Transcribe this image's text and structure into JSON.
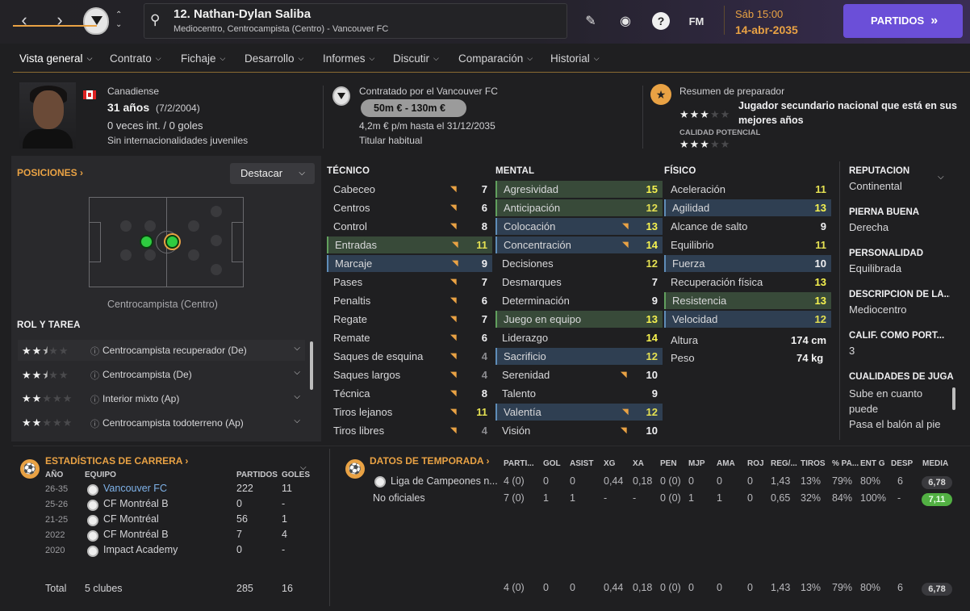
{
  "header": {
    "player_name": "12. Nathan-Dylan Saliba",
    "player_sub": "Mediocentro, Centrocampista (Centro) - Vancouver FC",
    "fm_label": "FM",
    "date_day": "Sáb 15:00",
    "date": "14-abr-2035",
    "partidos_label": "PARTIDOS",
    "icons": [
      "back-arrow-icon",
      "forward-arrow-icon",
      "club-crest-icon",
      "search-icon",
      "pencil-icon",
      "globe-icon",
      "help-icon"
    ]
  },
  "tabs": [
    {
      "label": "Vista general",
      "active": true
    },
    {
      "label": "Contrato"
    },
    {
      "label": "Fichaje"
    },
    {
      "label": "Desarrollo"
    },
    {
      "label": "Informes"
    },
    {
      "label": "Discutir"
    },
    {
      "label": "Comparación"
    },
    {
      "label": "Historial"
    }
  ],
  "profile": {
    "nationality": "Canadiense",
    "age": "31 años",
    "dob": "(7/2/2004)",
    "caps": "0 veces int. / 0 goles",
    "youth": "Sin internacionalidades juveniles"
  },
  "contract": {
    "signed_by": "Contratado por el Vancouver FC",
    "value": "50m € - 130m €",
    "wage": "4,2m € p/m hasta el 31/12/2035",
    "status": "Titular habitual"
  },
  "coach": {
    "title": "Resumen de preparador",
    "summary": "Jugador secundario nacional que está en sus mejores años",
    "current_stars": 3,
    "potential_label": "CALIDAD POTENCIAL",
    "potential_stars": 3
  },
  "positions": {
    "title": "POSICIONES",
    "destacar": "Destacar",
    "caption": "Centrocampista (Centro)",
    "roles_title": "ROL Y TAREA",
    "roles": [
      {
        "label": "Centrocampista recuperador (De)",
        "stars": 2.5,
        "selected": true
      },
      {
        "label": "Centrocampista (De)",
        "stars": 2.5
      },
      {
        "label": "Interior mixto (Ap)",
        "stars": 2
      },
      {
        "label": "Centrocampista todoterreno (Ap)",
        "stars": 2
      }
    ]
  },
  "attributes": {
    "tecnico_title": "TÉCNICO",
    "mental_title": "MENTAL",
    "fisico_title": "FÍSICO",
    "tecnico": [
      {
        "name": "Cabeceo",
        "value": "7",
        "arrow": true
      },
      {
        "name": "Centros",
        "value": "6",
        "arrow": true
      },
      {
        "name": "Control",
        "value": "8",
        "arrow": true
      },
      {
        "name": "Entradas",
        "value": "11",
        "arrow": true,
        "hl": "g"
      },
      {
        "name": "Marcaje",
        "value": "9",
        "arrow": true,
        "hl": "b"
      },
      {
        "name": "Pases",
        "value": "7",
        "arrow": true
      },
      {
        "name": "Penaltis",
        "value": "6",
        "arrow": true
      },
      {
        "name": "Regate",
        "value": "7",
        "arrow": true
      },
      {
        "name": "Remate",
        "value": "6",
        "arrow": true
      },
      {
        "name": "Saques de esquina",
        "value": "4",
        "arrow": true
      },
      {
        "name": "Saques largos",
        "value": "4",
        "arrow": true
      },
      {
        "name": "Técnica",
        "value": "8",
        "arrow": true
      },
      {
        "name": "Tiros lejanos",
        "value": "11",
        "arrow": true
      },
      {
        "name": "Tiros libres",
        "value": "4",
        "arrow": true
      }
    ],
    "mental": [
      {
        "name": "Agresividad",
        "value": "15",
        "hl": "g"
      },
      {
        "name": "Anticipación",
        "value": "12",
        "hl": "g"
      },
      {
        "name": "Colocación",
        "value": "13",
        "arrow": true,
        "hl": "b"
      },
      {
        "name": "Concentración",
        "value": "14",
        "arrow": true,
        "hl": "b"
      },
      {
        "name": "Decisiones",
        "value": "12"
      },
      {
        "name": "Desmarques",
        "value": "7"
      },
      {
        "name": "Determinación",
        "value": "9"
      },
      {
        "name": "Juego en equipo",
        "value": "13",
        "hl": "g"
      },
      {
        "name": "Liderazgo",
        "value": "14"
      },
      {
        "name": "Sacrificio",
        "value": "12",
        "hl": "b"
      },
      {
        "name": "Serenidad",
        "value": "10",
        "arrow": true
      },
      {
        "name": "Talento",
        "value": "9"
      },
      {
        "name": "Valentía",
        "value": "12",
        "arrow": true,
        "hl": "b"
      },
      {
        "name": "Visión",
        "value": "10",
        "arrow": true
      }
    ],
    "fisico": [
      {
        "name": "Aceleración",
        "value": "11"
      },
      {
        "name": "Agilidad",
        "value": "13",
        "hl": "b"
      },
      {
        "name": "Alcance de salto",
        "value": "9"
      },
      {
        "name": "Equilibrio",
        "value": "11"
      },
      {
        "name": "Fuerza",
        "value": "10",
        "hl": "b"
      },
      {
        "name": "Recuperación física",
        "value": "13"
      },
      {
        "name": "Resistencia",
        "value": "13",
        "hl": "g"
      },
      {
        "name": "Velocidad",
        "value": "12",
        "hl": "b"
      }
    ],
    "height_label": "Altura",
    "height": "174 cm",
    "weight_label": "Peso",
    "weight": "74 kg"
  },
  "info": [
    {
      "label": "REPUTACIÓN",
      "value": "Continental"
    },
    {
      "label": "PIERNA BUENA",
      "value": "Derecha"
    },
    {
      "label": "PERSONALIDAD",
      "value": "Equilibrada"
    },
    {
      "label": "DESCRIPCIÓN DE LA...",
      "value": "Mediocentro"
    },
    {
      "label": "CALIF. COMO PORT...",
      "value": "3"
    },
    {
      "label": "CUALIDADES DE JUGA",
      "value": "Sube en cuanto puede\nPasa el balón al pie"
    }
  ],
  "career": {
    "title": "ESTADÍSTICAS DE CARRERA",
    "headers": [
      "AÑO",
      "EQUIPO",
      "PARTIDOS",
      "GOLES"
    ],
    "rows": [
      {
        "year": "26-35",
        "team": "Vancouver FC",
        "apps": "222",
        "goals": "11",
        "highlight": true
      },
      {
        "year": "25-26",
        "team": "CF Montréal B",
        "apps": "0",
        "goals": "-"
      },
      {
        "year": "21-25",
        "team": "CF Montréal",
        "apps": "56",
        "goals": "1"
      },
      {
        "year": "2022",
        "team": "CF Montréal B",
        "apps": "7",
        "goals": "4"
      },
      {
        "year": "2020",
        "team": "Impact Academy",
        "apps": "0",
        "goals": "-"
      }
    ],
    "total_label": "Total",
    "total_clubs": "5 clubes",
    "total_apps": "285",
    "total_goals": "16"
  },
  "season": {
    "title": "DATOS DE TEMPORADA",
    "headers": [
      "PARTI...",
      "GOL",
      "ASIST",
      "XG",
      "XA",
      "PEN",
      "MJP",
      "AMA",
      "ROJ",
      "REG/...",
      "TIROS",
      "% PA...",
      "ENT G",
      "DESP",
      "MEDIA"
    ],
    "rows": [
      {
        "comp": "Liga de Campeones n...",
        "vals": [
          "4 (0)",
          "0",
          "0",
          "0,44",
          "0,18",
          "0 (0)",
          "0",
          "0",
          "0",
          "1,43",
          "13%",
          "79%",
          "80%",
          "6"
        ],
        "rating": "6,78",
        "green": false
      },
      {
        "comp": "No oficiales",
        "vals": [
          "7 (0)",
          "1",
          "1",
          "-",
          "-",
          "0 (0)",
          "1",
          "1",
          "0",
          "0,65",
          "32%",
          "84%",
          "100%",
          "-"
        ],
        "rating": "7,11",
        "green": true
      }
    ],
    "total": {
      "vals": [
        "4 (0)",
        "0",
        "0",
        "0,44",
        "0,18",
        "0 (0)",
        "0",
        "0",
        "0",
        "1,43",
        "13%",
        "79%",
        "80%",
        "6"
      ],
      "rating": "6,78"
    }
  }
}
